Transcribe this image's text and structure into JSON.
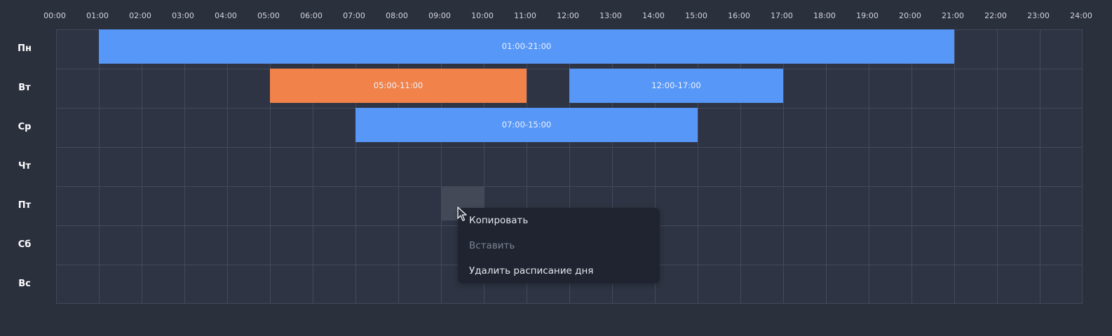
{
  "hours": [
    "00:00",
    "01:00",
    "02:00",
    "03:00",
    "04:00",
    "05:00",
    "06:00",
    "07:00",
    "08:00",
    "09:00",
    "10:00",
    "11:00",
    "12:00",
    "13:00",
    "14:00",
    "15:00",
    "16:00",
    "17:00",
    "18:00",
    "19:00",
    "20:00",
    "21:00",
    "22:00",
    "23:00",
    "24:00"
  ],
  "days": [
    "Пн",
    "Вт",
    "Ср",
    "Чт",
    "Пт",
    "Сб",
    "Вс"
  ],
  "colors": {
    "slot_blue": "#5797f7",
    "slot_orange": "#f0824a"
  },
  "slots": [
    {
      "day": 0,
      "start": 1,
      "end": 21,
      "label": "01:00-21:00",
      "color": "slot_blue"
    },
    {
      "day": 1,
      "start": 5,
      "end": 11,
      "label": "05:00-11:00",
      "color": "slot_orange"
    },
    {
      "day": 1,
      "start": 12,
      "end": 17,
      "label": "12:00-17:00",
      "color": "slot_blue"
    },
    {
      "day": 2,
      "start": 7,
      "end": 15,
      "label": "07:00-15:00",
      "color": "slot_blue"
    }
  ],
  "hover_cell": {
    "day": 4,
    "hour": 9
  },
  "context_menu": {
    "copy": "Копировать",
    "paste": "Вставить",
    "delete_day": "Удалить расписание дня"
  }
}
